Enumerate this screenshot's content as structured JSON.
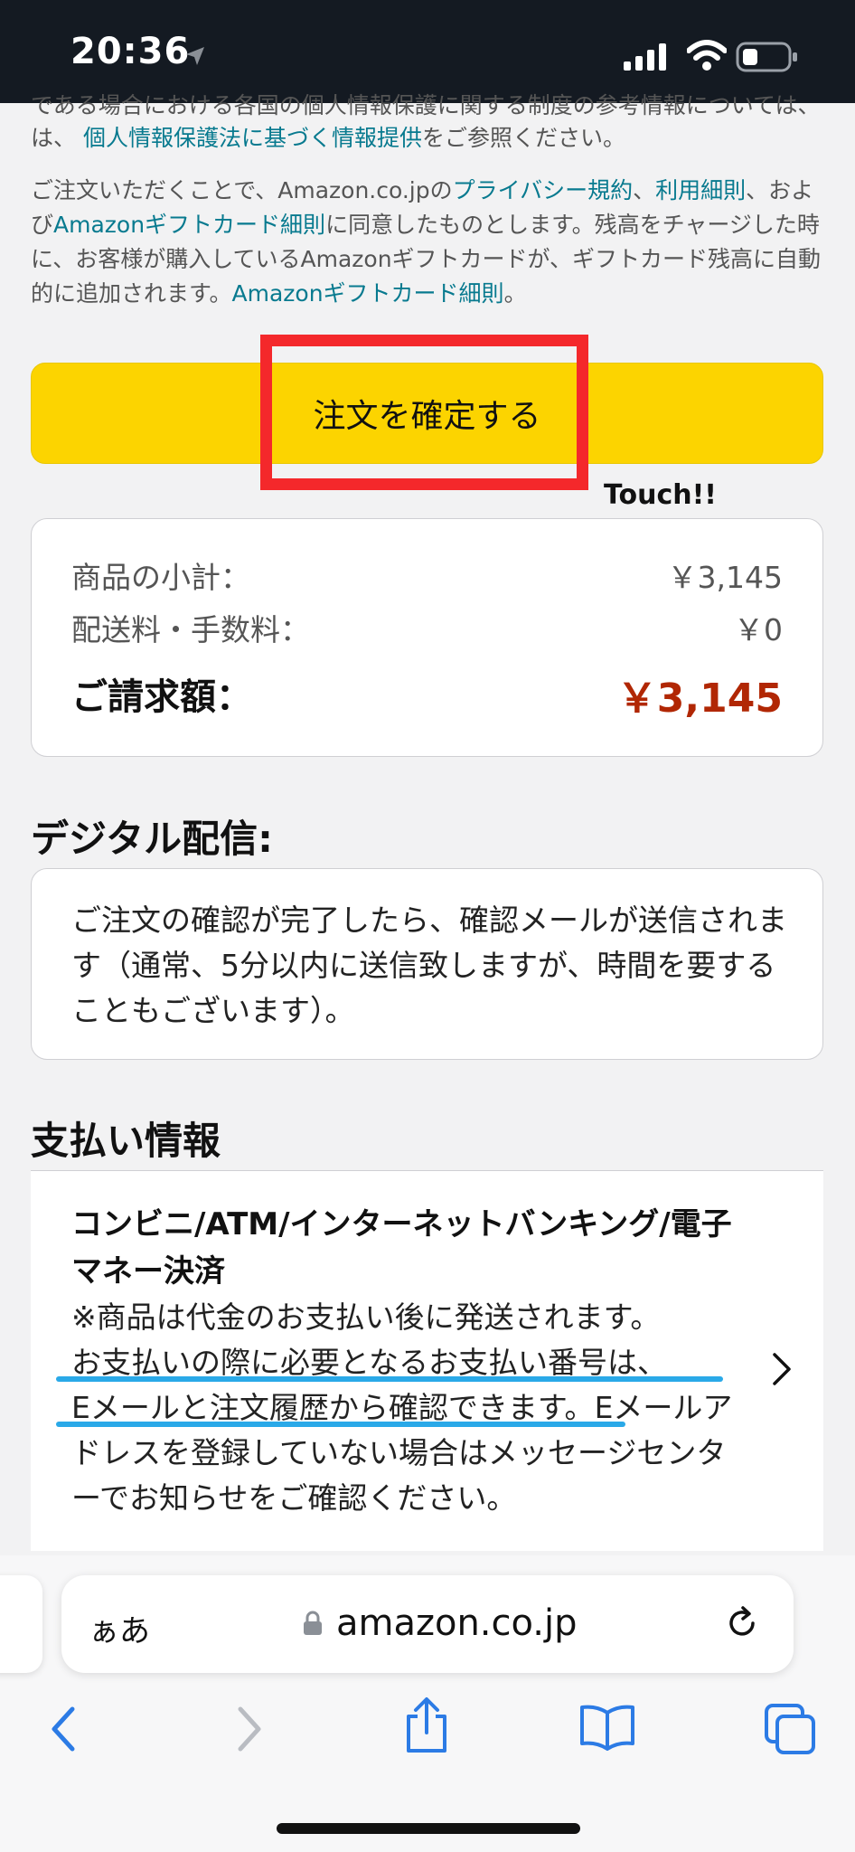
{
  "status_bar": {
    "time": "20:36"
  },
  "legal": {
    "line0": "である場合における各国の個人情報保護に関する制度の参考情報については、",
    "line1_prefix": "は、",
    "line1_link": "個人情報保護法に基づく情報提供",
    "line1_suffix": "をご参照ください。",
    "p2_text1": "ご注文いただくことで、Amazon.co.jpの",
    "p2_link1": "プライバシー規約",
    "p2_text2": "、",
    "p2_link2": "利用細則",
    "p2_text3": "、および",
    "p2_link3": "Amazonギフトカード細則",
    "p2_text4": "に同意したものとします。残高をチャージした時に、お客様が購入しているAmazonギフトカードが、ギフトカード残高に自動的に追加されます。",
    "p2_link4": "Amazonギフトカード細則",
    "p2_text5": "。"
  },
  "order_button": {
    "label": "注文を確定する",
    "annotation": "Touch!!"
  },
  "summary": {
    "subtotal_label": "商品の小計：",
    "subtotal_value": "￥3,145",
    "shipping_label": "配送料・手数料：",
    "shipping_value": "￥0",
    "total_label": "ご請求額：",
    "total_value": "￥3,145"
  },
  "digital": {
    "title": "デジタル配信:",
    "text": "ご注文の確認が完了したら、確認メールが送信されます（通常、5分以内に送信致しますが、時間を要することもございます）。"
  },
  "payment": {
    "title": "支払い情報",
    "method_title": "コンビニ/ATM/インターネットバンキング/電子マネー決済",
    "note1": "※商品は代金のお支払い後に発送されます。",
    "note2": "お支払いの際に必要となるお支払い番号は、",
    "note3": "Eメールと注文履歴から確認できます。",
    "note4": "Eメールアドレスを登録していない場合はメッセージセンターでお知らせをご確認ください。"
  },
  "browser": {
    "text_size_button": "ぁあ",
    "url": "amazon.co.jp"
  },
  "colors": {
    "button": "#fcd400",
    "highlight_box": "#f4282b",
    "price": "#b12704",
    "link": "#087a8f",
    "underline": "#2aa9e8"
  }
}
